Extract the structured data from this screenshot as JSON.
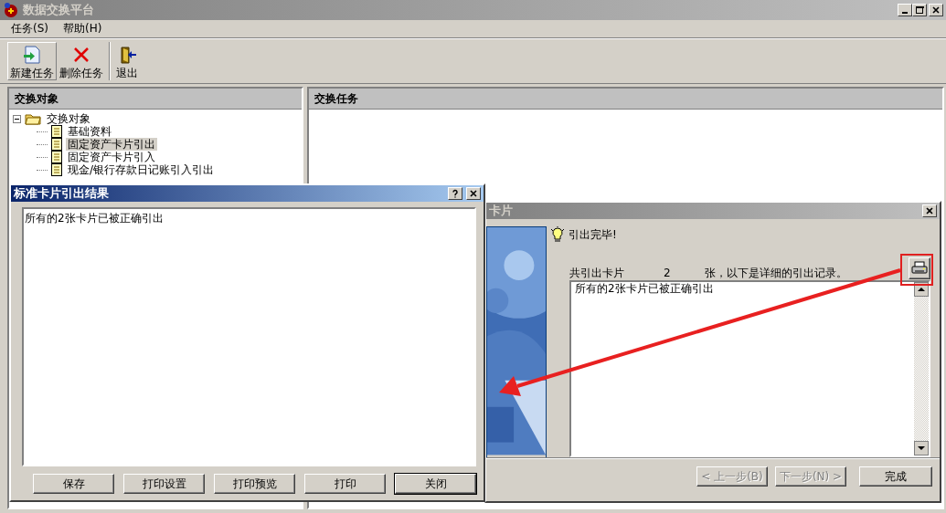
{
  "main_window": {
    "title": "数据交换平台",
    "menu": [
      {
        "label": "任务(S)"
      },
      {
        "label": "帮助(H)"
      }
    ],
    "toolbar": [
      {
        "label": "新建任务",
        "kind": "new",
        "pressed": true
      },
      {
        "label": "删除任务",
        "kind": "delete",
        "pressed": false
      },
      {
        "label": "退出",
        "kind": "exit",
        "pressed": false
      }
    ],
    "left_pane": {
      "header": "交换对象",
      "tree": [
        {
          "label": "交换对象",
          "expanded": true,
          "selected": false,
          "children": [
            {
              "label": "基础资料",
              "selected": false
            },
            {
              "label": "固定资产卡片引出",
              "selected": true
            },
            {
              "label": "固定资产卡片引入",
              "selected": false
            },
            {
              "label": "现金/银行存款日记账引入引出",
              "selected": false
            }
          ]
        }
      ]
    },
    "right_pane": {
      "header": "交换任务"
    }
  },
  "wizard": {
    "title": "卡片",
    "message": "引出完毕!",
    "count_label": "共引出卡片",
    "count": "2",
    "count_suffix": "张，以下是详细的引出记录。",
    "log": "所有的2张卡片已被正确引出",
    "buttons": [
      {
        "label": "< 上一步(B)",
        "disabled": true
      },
      {
        "label": "下一步(N) >",
        "disabled": true
      },
      {
        "label": "完成",
        "disabled": false
      }
    ]
  },
  "result_dialog": {
    "title": "标准卡片引出结果",
    "text": "所有的2张卡片已被正确引出",
    "buttons": [
      {
        "label": "保存",
        "default": false
      },
      {
        "label": "打印设置",
        "default": false
      },
      {
        "label": "打印预览",
        "default": false
      },
      {
        "label": "打印",
        "default": false
      },
      {
        "label": "关闭",
        "default": true
      }
    ]
  }
}
